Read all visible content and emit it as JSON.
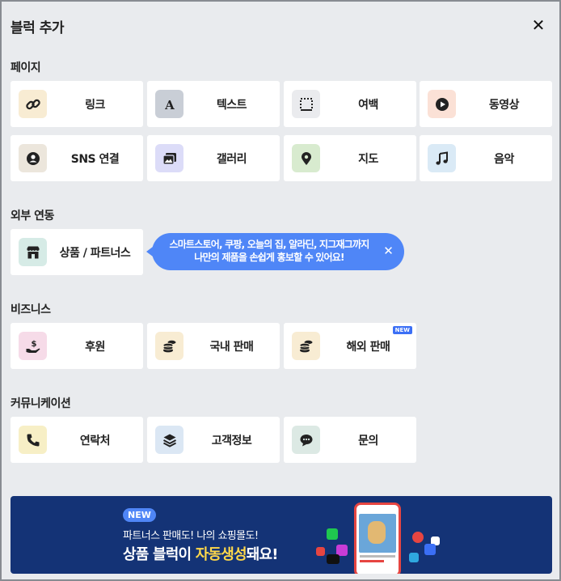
{
  "header": {
    "title": "블럭 추가",
    "close_glyph": "✕"
  },
  "sections": {
    "page": {
      "title": "페이지",
      "items": [
        {
          "label": "링크",
          "icon": "link-icon"
        },
        {
          "label": "텍스트",
          "icon": "text-icon"
        },
        {
          "label": "여백",
          "icon": "spacer-icon"
        },
        {
          "label": "동영상",
          "icon": "video-icon"
        },
        {
          "label": "SNS 연결",
          "icon": "profile-icon"
        },
        {
          "label": "갤러리",
          "icon": "gallery-icon"
        },
        {
          "label": "지도",
          "icon": "map-pin-icon"
        },
        {
          "label": "음악",
          "icon": "music-icon"
        }
      ]
    },
    "external": {
      "title": "외부 연동",
      "items": [
        {
          "label": "상품 / 파트너스",
          "icon": "store-icon"
        }
      ],
      "tooltip": {
        "line1": "스마트스토어, 쿠팡, 오늘의 집, 알라딘, 지그재그까지",
        "line2": "나만의 제품을 손쉽게 홍보할 수 있어요!",
        "close_glyph": "✕"
      }
    },
    "business": {
      "title": "비즈니스",
      "items": [
        {
          "label": "후원",
          "icon": "donation-icon"
        },
        {
          "label": "국내 판매",
          "icon": "coins-icon"
        },
        {
          "label": "해외 판매",
          "icon": "coins-icon",
          "badge": "NEW"
        }
      ]
    },
    "communication": {
      "title": "커뮤니케이션",
      "items": [
        {
          "label": "연락처",
          "icon": "phone-icon"
        },
        {
          "label": "고객정보",
          "icon": "layers-icon"
        },
        {
          "label": "문의",
          "icon": "chat-bubble-icon"
        }
      ]
    }
  },
  "banner": {
    "badge": "NEW",
    "line1": "파트너스 판매도! 나의 쇼핑몰도!",
    "line2_prefix": "상품 블럭이 ",
    "line2_highlight": "자동생성",
    "line2_suffix": "돼요!"
  },
  "colors": {
    "background": "#e9ebee",
    "card": "#ffffff",
    "tooltip": "#4f86f7",
    "banner": "#143376",
    "highlight": "#ffd84a",
    "badge": "#3b6ff5"
  }
}
